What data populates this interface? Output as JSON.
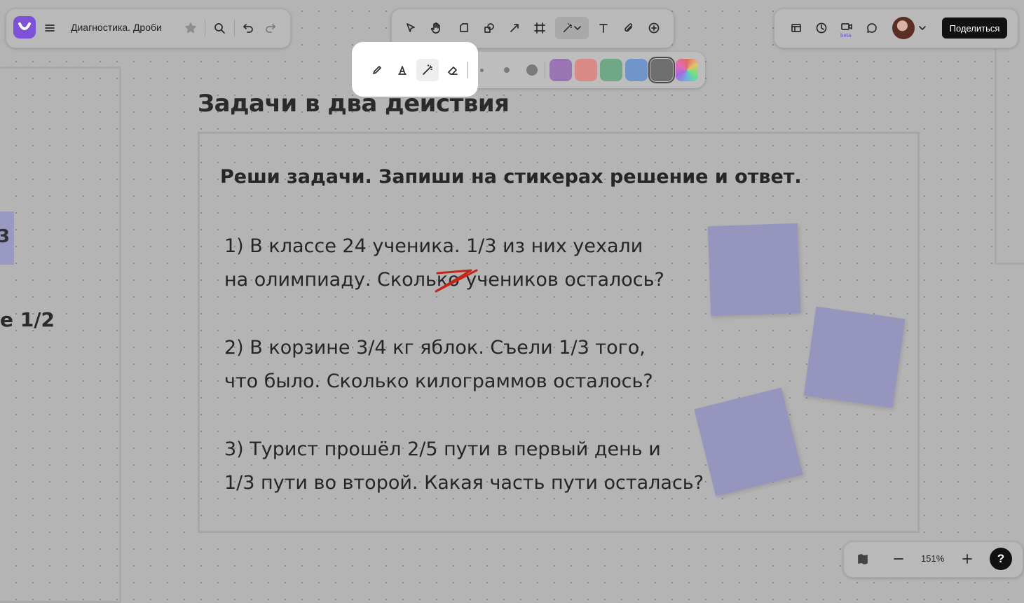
{
  "header": {
    "title": "Диагностика. Дроби",
    "share_label": "Поделиться",
    "beta_label": "beta",
    "accent_color": "#7d52d6"
  },
  "canvas": {
    "left_text": "е 1/2",
    "left_sticky_text": "3",
    "heading": "Задачи в два действия",
    "instruction": "Реши задачи. Запиши на стикерах решение и ответ.",
    "tasks": [
      {
        "line1": "1) В классе 24 ученика. 1/3 из них уехали",
        "line2": "на олимпиаду. Сколько учеников осталось?"
      },
      {
        "line1": "2) В корзине 3/4 кг яблок. Съели 1/3 того,",
        "line2": "что было. Сколько килограммов осталось?"
      },
      {
        "line1": "3) Турист прошёл 2/5 пути в первый день и",
        "line2": "1/3 пути во второй. Какая часть пути осталась?"
      }
    ],
    "sticky_color": "#9695bd",
    "strike_color": "#c0281c"
  },
  "draw_toolbar": {
    "tools": [
      "pencil-icon",
      "highlighter-icon",
      "magic-pen-icon",
      "eraser-icon"
    ],
    "active_tool": "magic-pen-icon",
    "colors": [
      "#9b74b4",
      "#d98a86",
      "#6fa886",
      "#6f95c9",
      "#6f6f6f"
    ]
  },
  "zoom": {
    "level": "151%"
  },
  "help": {
    "label": "?"
  }
}
